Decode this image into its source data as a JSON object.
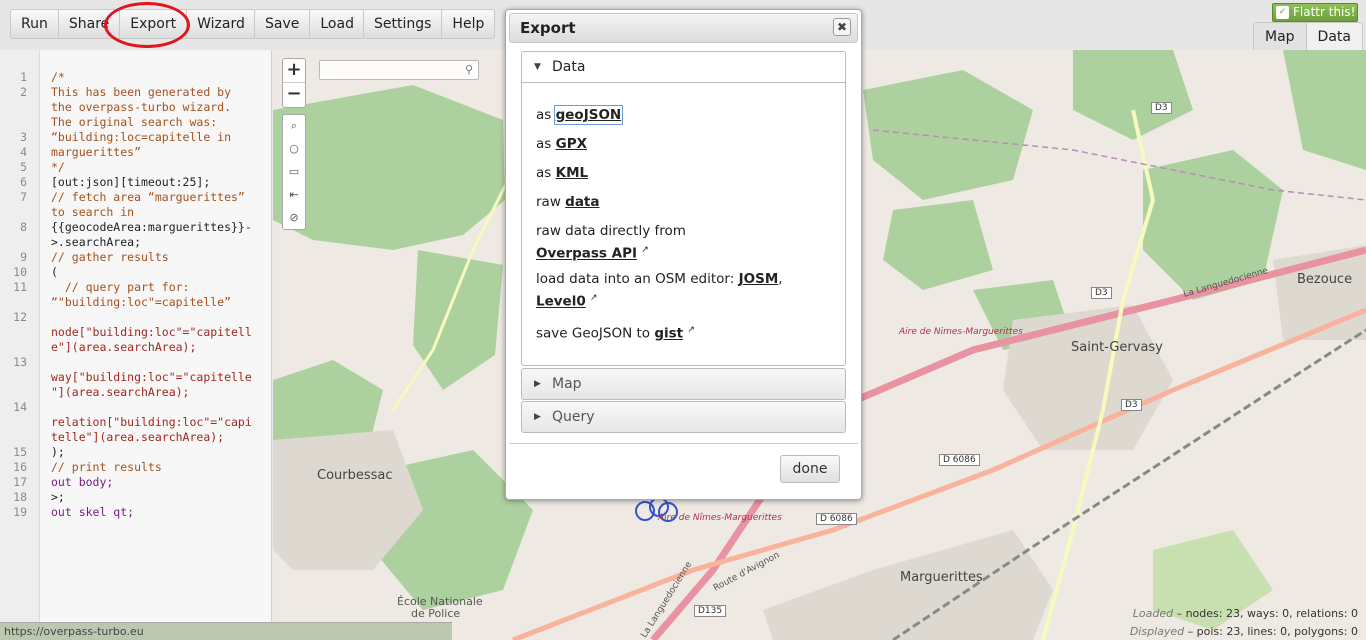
{
  "toolbar": {
    "run": "Run",
    "share": "Share",
    "export": "Export",
    "wizard": "Wizard",
    "save": "Save",
    "load": "Load",
    "settings": "Settings",
    "help": "Help",
    "flattr": "Flattr this!",
    "view_tabs": [
      "Map",
      "Data"
    ],
    "active_view": "Map"
  },
  "editor": {
    "line_numbers": [
      "1",
      "2",
      "3",
      "4",
      "5",
      "6",
      "7",
      "8",
      "9",
      "10",
      "11",
      "12",
      "13",
      "14",
      "15",
      "16",
      "17",
      "18",
      "19"
    ],
    "lines": [
      "/*",
      "This has been generated by",
      "the overpass-turbo wizard.",
      "The original search was:",
      "“building:loc=capitelle in",
      "marguerittes”",
      "*/",
      "[out:json][timeout:25];",
      "// fetch area “marguerittes”",
      "to search in",
      "{{geocodeArea:marguerittes}}-",
      ">.searchArea;",
      "// gather results",
      "(",
      "  // query part for:",
      "“\"building:loc\"=capitelle”",
      "node[\"building:loc\"=\"capitell",
      "e\"](area.searchArea);",
      "way[\"building:loc\"=\"capitelle",
      "\"](area.searchArea);",
      "relation[\"building:loc\"=\"capi",
      "telle\"](area.searchArea);",
      ");",
      "// print results",
      "out body;",
      ">;",
      "out skel qt;"
    ]
  },
  "map": {
    "search_placeholder": "",
    "labels": {
      "courbessac": "Courbessac",
      "saint_gervasy": "Saint-Gervasy",
      "bezouce": "Bezouce",
      "marguerittes": "Marguerittes",
      "ecole": "École Nationale",
      "ecole2": "de Police",
      "aire1": "Aire de Nimes-Marguerittes",
      "aire2": "Aire de Nîmes-Marguerittes",
      "languedocienne": "La Languedocienne",
      "languedocienne2": "La Languedocienne",
      "route_avignon": "Route d'Avignon"
    },
    "roads": [
      "D3",
      "D3",
      "D3",
      "D 6086",
      "D 6086",
      "D135"
    ],
    "status_loaded_label": "Loaded",
    "status_loaded": "– nodes: 23, ways: 0, relations: 0",
    "status_displayed_label": "Displayed",
    "status_displayed": "– pois: 23, lines: 0, polygons: 0"
  },
  "footer": {
    "url": "https://overpass-turbo.eu"
  },
  "dialog": {
    "title": "Export",
    "close": "✖",
    "section_data": "Data",
    "section_map": "Map",
    "section_query": "Query",
    "items": {
      "geojson_prefix": "as ",
      "geojson": "geoJSON",
      "gpx_prefix": "as ",
      "gpx": "GPX",
      "kml_prefix": "as ",
      "kml": "KML",
      "raw_prefix": "raw ",
      "raw": "data",
      "overpass_prefix": "raw data directly from",
      "overpass": "Overpass API",
      "editor_prefix": "load data into an OSM editor: ",
      "josm": "JOSM",
      "level0": "Level0",
      "gist_prefix": "save GeoJSON to ",
      "gist": "gist"
    },
    "done": "done"
  },
  "colors": {
    "forest": "#add19e",
    "motorway": "#e892a2",
    "trunk": "#f9b29c",
    "highlight_circle": "#e0161c"
  }
}
